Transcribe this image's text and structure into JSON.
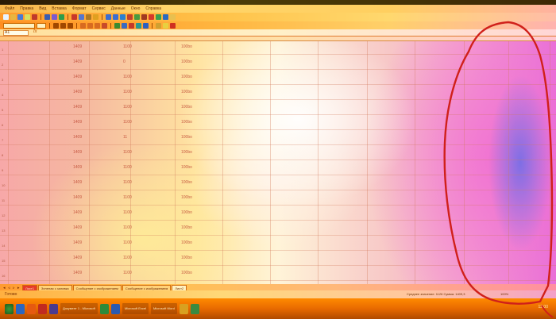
{
  "app": {
    "menu": [
      "Файл",
      "Правка",
      "Вид",
      "Вставка",
      "Формат",
      "Сервис",
      "Данные",
      "Окно",
      "Справка"
    ],
    "name_box": "A1"
  },
  "sheet": {
    "rows": [
      {
        "n": "1",
        "a": "1409",
        "b": "1100",
        "c": "100bo"
      },
      {
        "n": "2",
        "a": "1409",
        "b": "0",
        "c": "100bo"
      },
      {
        "n": "3",
        "a": "1409",
        "b": "1100",
        "c": "100bo"
      },
      {
        "n": "4",
        "a": "1409",
        "b": "1100",
        "c": "100bo"
      },
      {
        "n": "5",
        "a": "1409",
        "b": "1100",
        "c": "100bo"
      },
      {
        "n": "6",
        "a": "1409",
        "b": "1100",
        "c": "100bo"
      },
      {
        "n": "7",
        "a": "1409",
        "b": "11",
        "c": "100bo"
      },
      {
        "n": "8",
        "a": "1409",
        "b": "1100",
        "c": "100bo"
      },
      {
        "n": "9",
        "a": "1409",
        "b": "1100",
        "c": "100bo"
      },
      {
        "n": "10",
        "a": "1409",
        "b": "1100",
        "c": "100bo"
      },
      {
        "n": "11",
        "a": "1409",
        "b": "1100",
        "c": "100bo"
      },
      {
        "n": "12",
        "a": "1409",
        "b": "1100",
        "c": "100bo"
      },
      {
        "n": "13",
        "a": "1409",
        "b": "1100",
        "c": "100bo"
      },
      {
        "n": "14",
        "a": "1409",
        "b": "1100",
        "c": "100bo"
      },
      {
        "n": "15",
        "a": "1409",
        "b": "1100",
        "c": "100bo"
      },
      {
        "n": "16",
        "a": "1409",
        "b": "1100",
        "c": "100bo"
      }
    ]
  },
  "tabs": [
    {
      "label": "Лист1",
      "style": "red"
    },
    {
      "label": "Зеленая с заливка",
      "style": ""
    },
    {
      "label": "Сообщение с изображением",
      "style": ""
    },
    {
      "label": "Сообщение с изображением",
      "style": ""
    },
    {
      "label": "Лист2",
      "style": "active"
    }
  ],
  "status": {
    "ready": "Готово",
    "sum": "Среднее значение: 1126  Сумма: 1409,3",
    "zoom": "100%"
  },
  "taskbar": {
    "buttons": [
      "Документ 1 - Microsoft",
      "Microsoft Excel",
      "Microsoft Word"
    ],
    "clock": "12:00"
  },
  "colors": {
    "annotation": "#d0201a",
    "accent": "#ff8a00"
  }
}
